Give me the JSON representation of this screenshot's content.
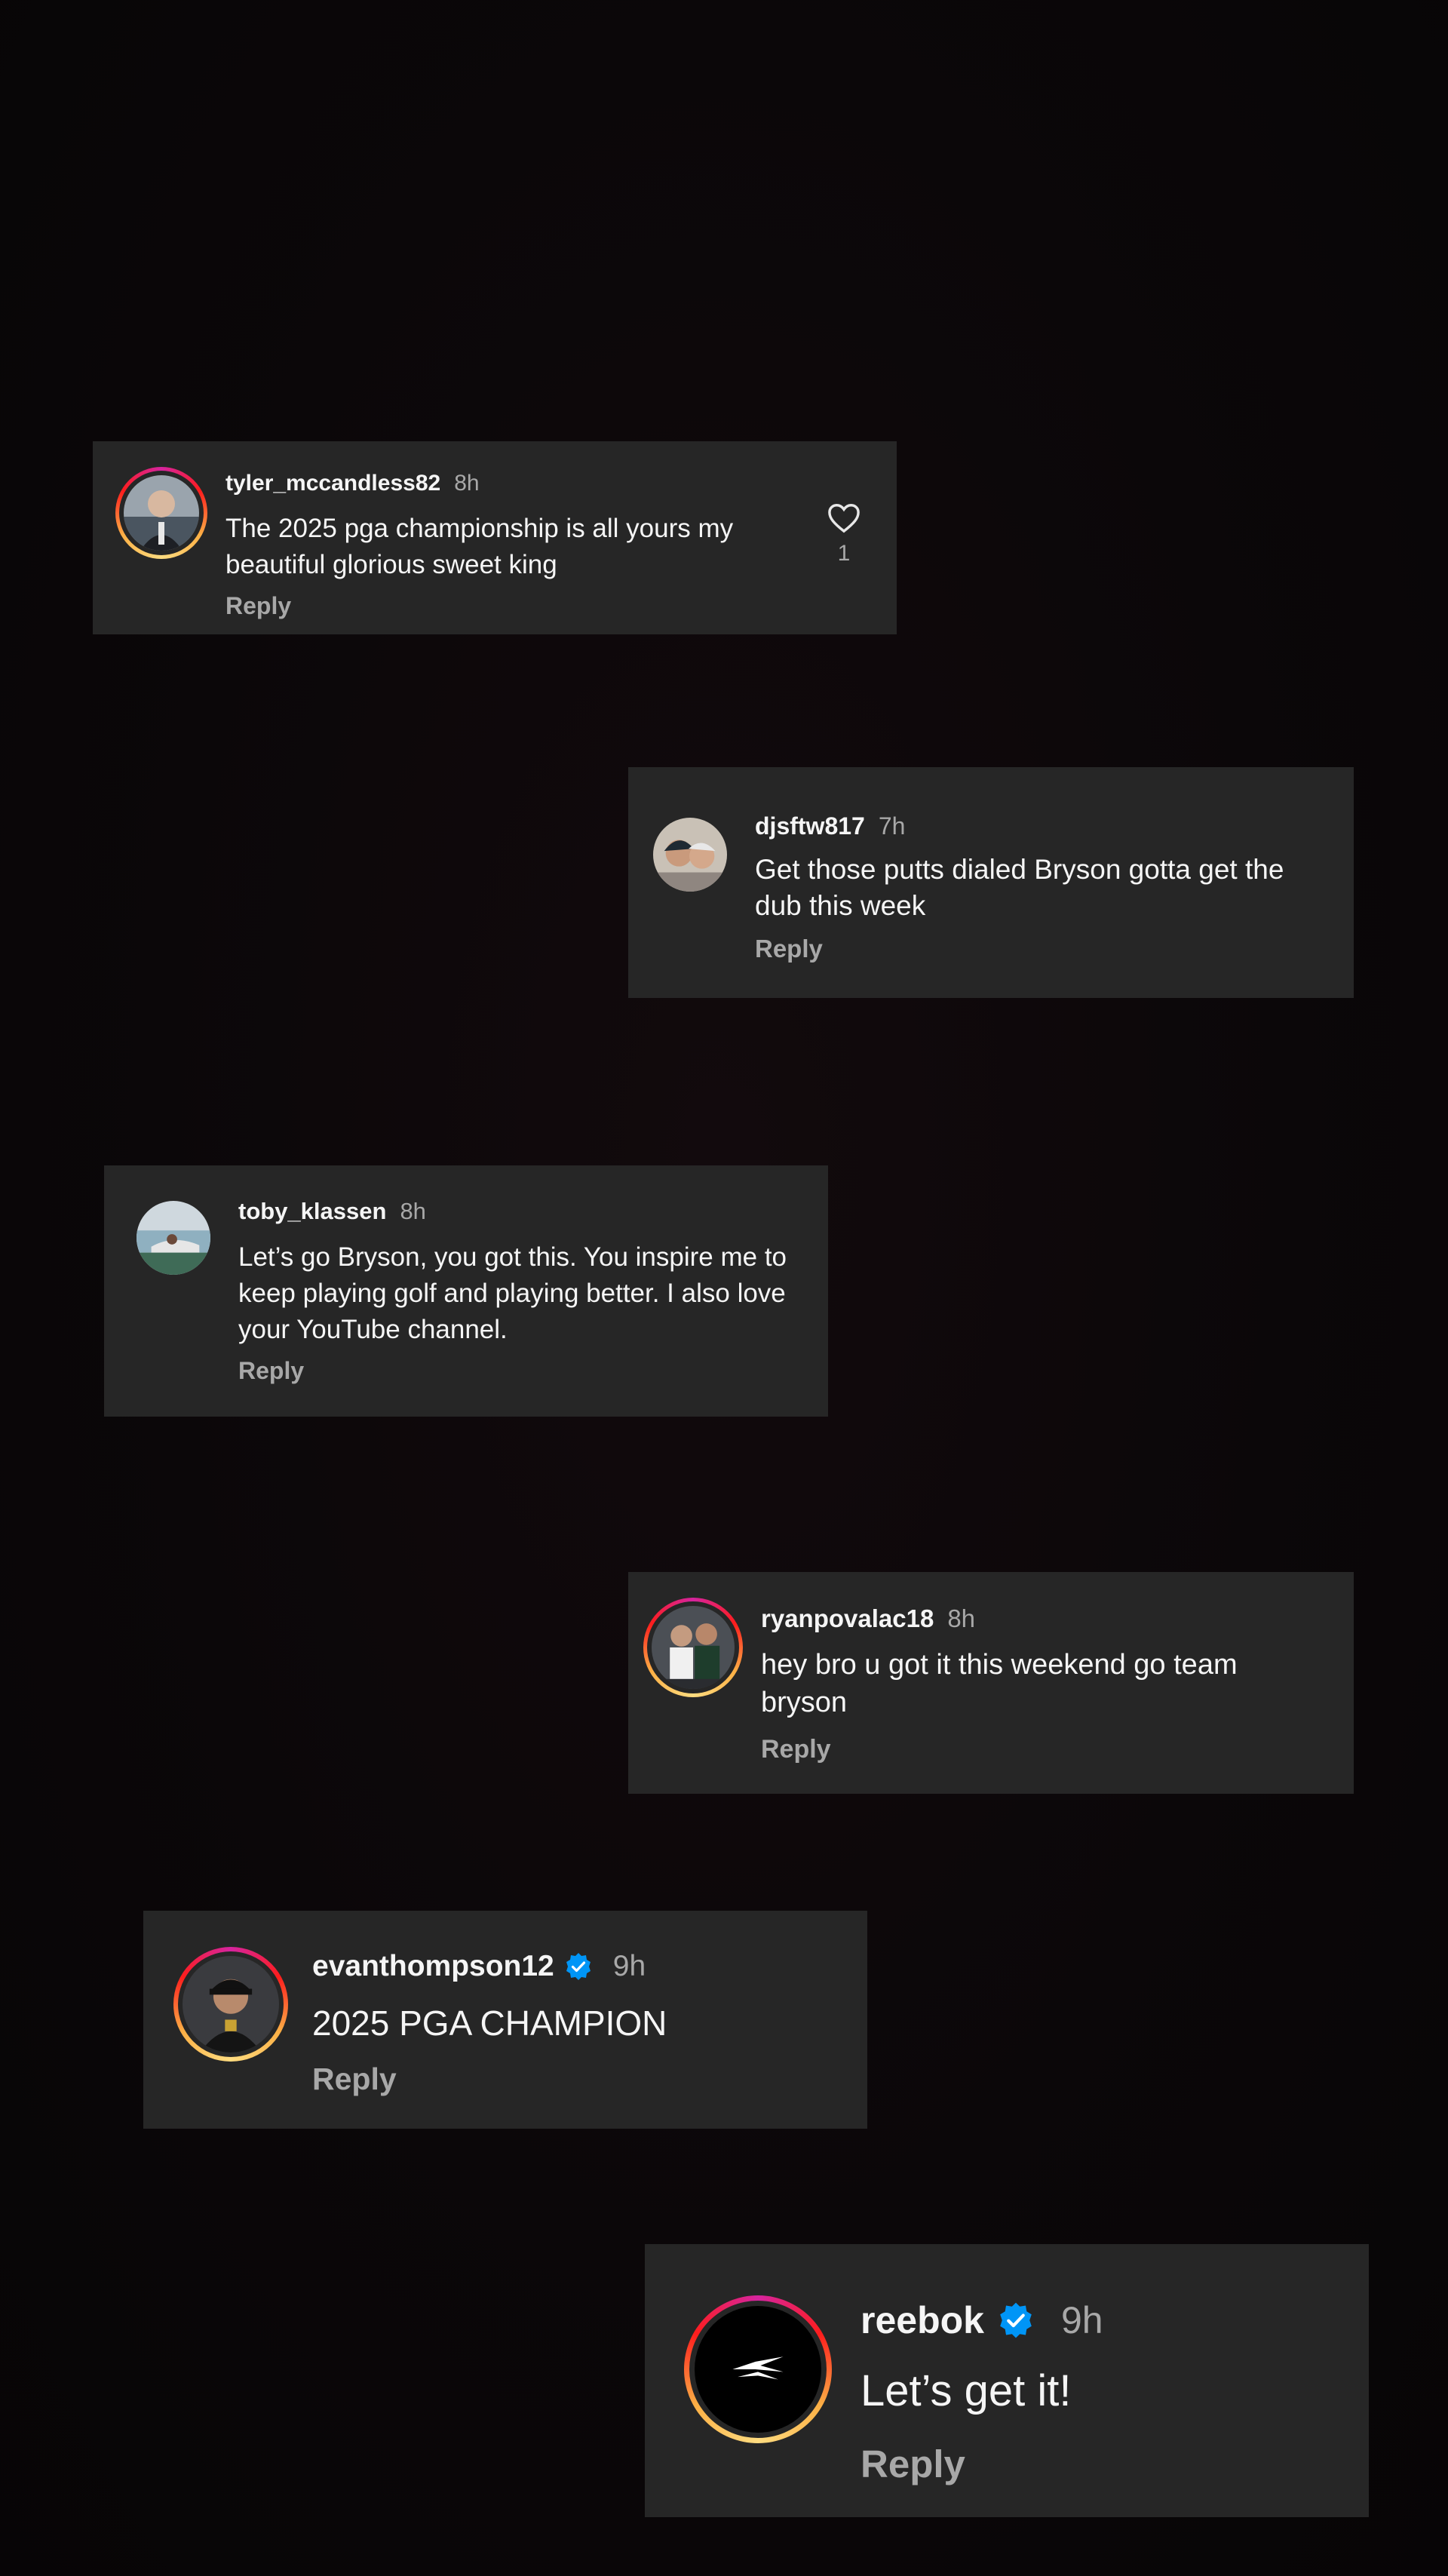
{
  "comments": [
    {
      "username": "tyler_mccandless82",
      "time": "8h",
      "text": "The 2025 pga championship is all yours my beautiful glorious sweet king",
      "reply_label": "Reply",
      "like_count": "1",
      "avatar_icon": "user-avatar"
    },
    {
      "username": "djsftw817",
      "time": "7h",
      "text": "Get those putts dialed Bryson gotta get the dub this week",
      "reply_label": "Reply",
      "avatar_icon": "user-avatar"
    },
    {
      "username": "toby_klassen",
      "time": "8h",
      "text": "Let’s go Bryson, you got this. You inspire me to keep playing golf and playing better. I also love your YouTube channel.",
      "reply_label": "Reply",
      "avatar_icon": "user-avatar"
    },
    {
      "username": "ryanpovalac18",
      "time": "8h",
      "text": "hey bro u got it this weekend go team bryson",
      "reply_label": "Reply",
      "avatar_icon": "user-avatar"
    },
    {
      "username": "evanthompson12",
      "verified": true,
      "time": "9h",
      "text": "2025 PGA CHAMPION",
      "reply_label": "Reply",
      "avatar_icon": "user-avatar"
    },
    {
      "username": "reebok",
      "verified": true,
      "time": "9h",
      "text": "Let’s get it!",
      "reply_label": "Reply",
      "avatar_icon": "reebok-logo"
    }
  ],
  "colors": {
    "card_bg": "#262626",
    "text_primary": "#f5f5f5",
    "text_secondary": "#a8a8a8",
    "verified_blue": "#0095f6"
  }
}
